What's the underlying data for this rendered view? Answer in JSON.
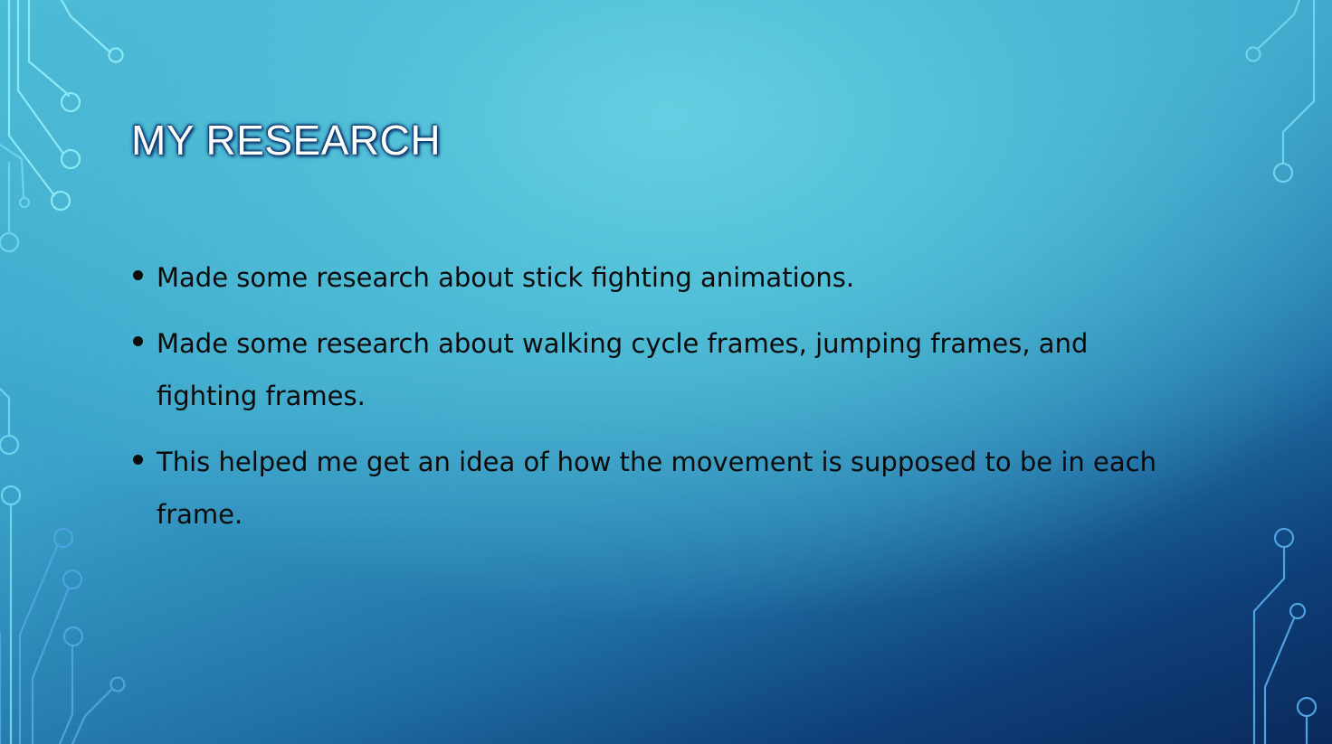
{
  "slide": {
    "title": "MY RESEARCH",
    "bullets": [
      "Made some research about stick fighting animations.",
      "Made some research about walking cycle frames, jumping frames, and fighting frames.",
      "This helped me get an idea of how the movement is supposed to be in each frame."
    ]
  },
  "theme": {
    "background_top": "#66cfe2",
    "background_bottom": "#0a2a5c",
    "circuit_color": "#8be8f4",
    "title_color": "#ffffff",
    "text_color": "#0b0b0b"
  }
}
